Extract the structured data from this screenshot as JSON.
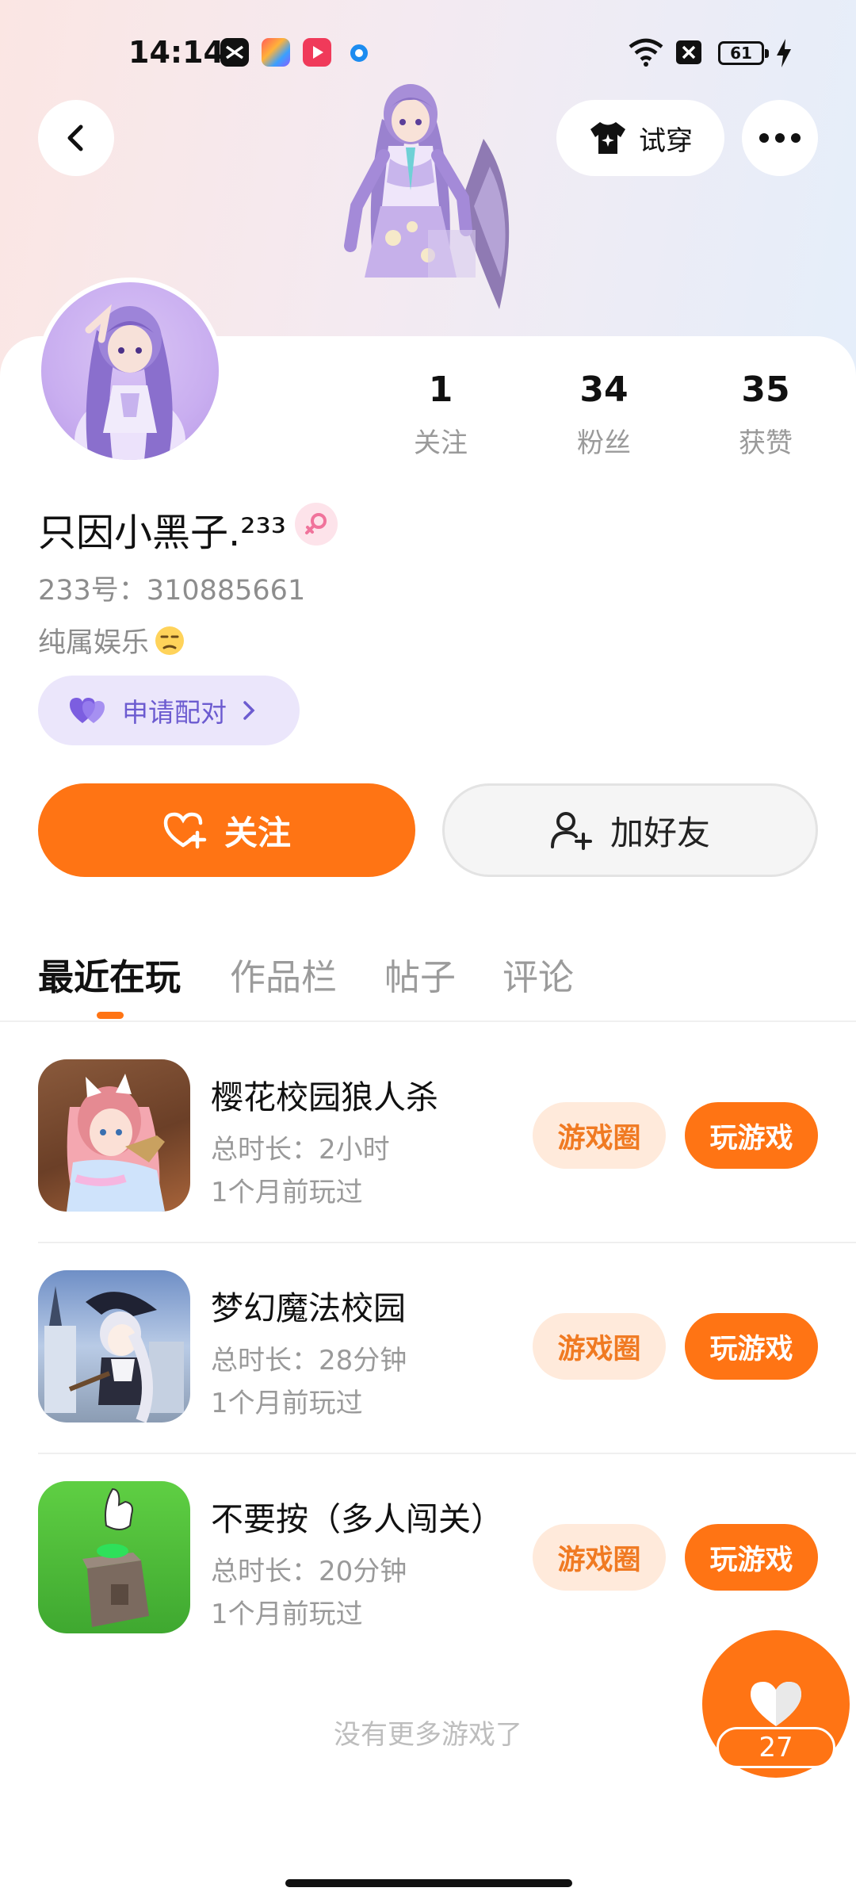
{
  "status_bar": {
    "time": "14:14",
    "battery": "61",
    "app_icons": [
      "capcut-icon",
      "color-app-icon",
      "video-app-icon",
      "dot-app-icon"
    ]
  },
  "header": {
    "try_on_label": "试穿"
  },
  "profile": {
    "stats": [
      {
        "value": "1",
        "label": "关注"
      },
      {
        "value": "34",
        "label": "粉丝"
      },
      {
        "value": "35",
        "label": "获赞"
      }
    ],
    "username": "只因小黑子.²³³",
    "uid": "233号：310885661",
    "bio": "纯属娱乐",
    "pair_label": "申请配对"
  },
  "actions": {
    "follow_label": "关注",
    "add_friend_label": "加好友"
  },
  "tabs": [
    "最近在玩",
    "作品栏",
    "帖子",
    "评论"
  ],
  "games": [
    {
      "title": "樱花校园狼人杀",
      "duration": "总时长：2小时",
      "played": "1个月前玩过",
      "circle_label": "游戏圈",
      "play_label": "玩游戏"
    },
    {
      "title": "梦幻魔法校园",
      "duration": "总时长：28分钟",
      "played": "1个月前玩过",
      "circle_label": "游戏圈",
      "play_label": "玩游戏"
    },
    {
      "title": "不要按（多人闯关）",
      "duration": "总时长：20分钟",
      "played": "1个月前玩过",
      "circle_label": "游戏圈",
      "play_label": "玩游戏"
    }
  ],
  "footer": {
    "no_more": "没有更多游戏了",
    "like_count": "27"
  },
  "colors": {
    "accent": "#ff7414",
    "pair_bg": "#ebe6fb",
    "pair_text": "#6c5bd0"
  }
}
